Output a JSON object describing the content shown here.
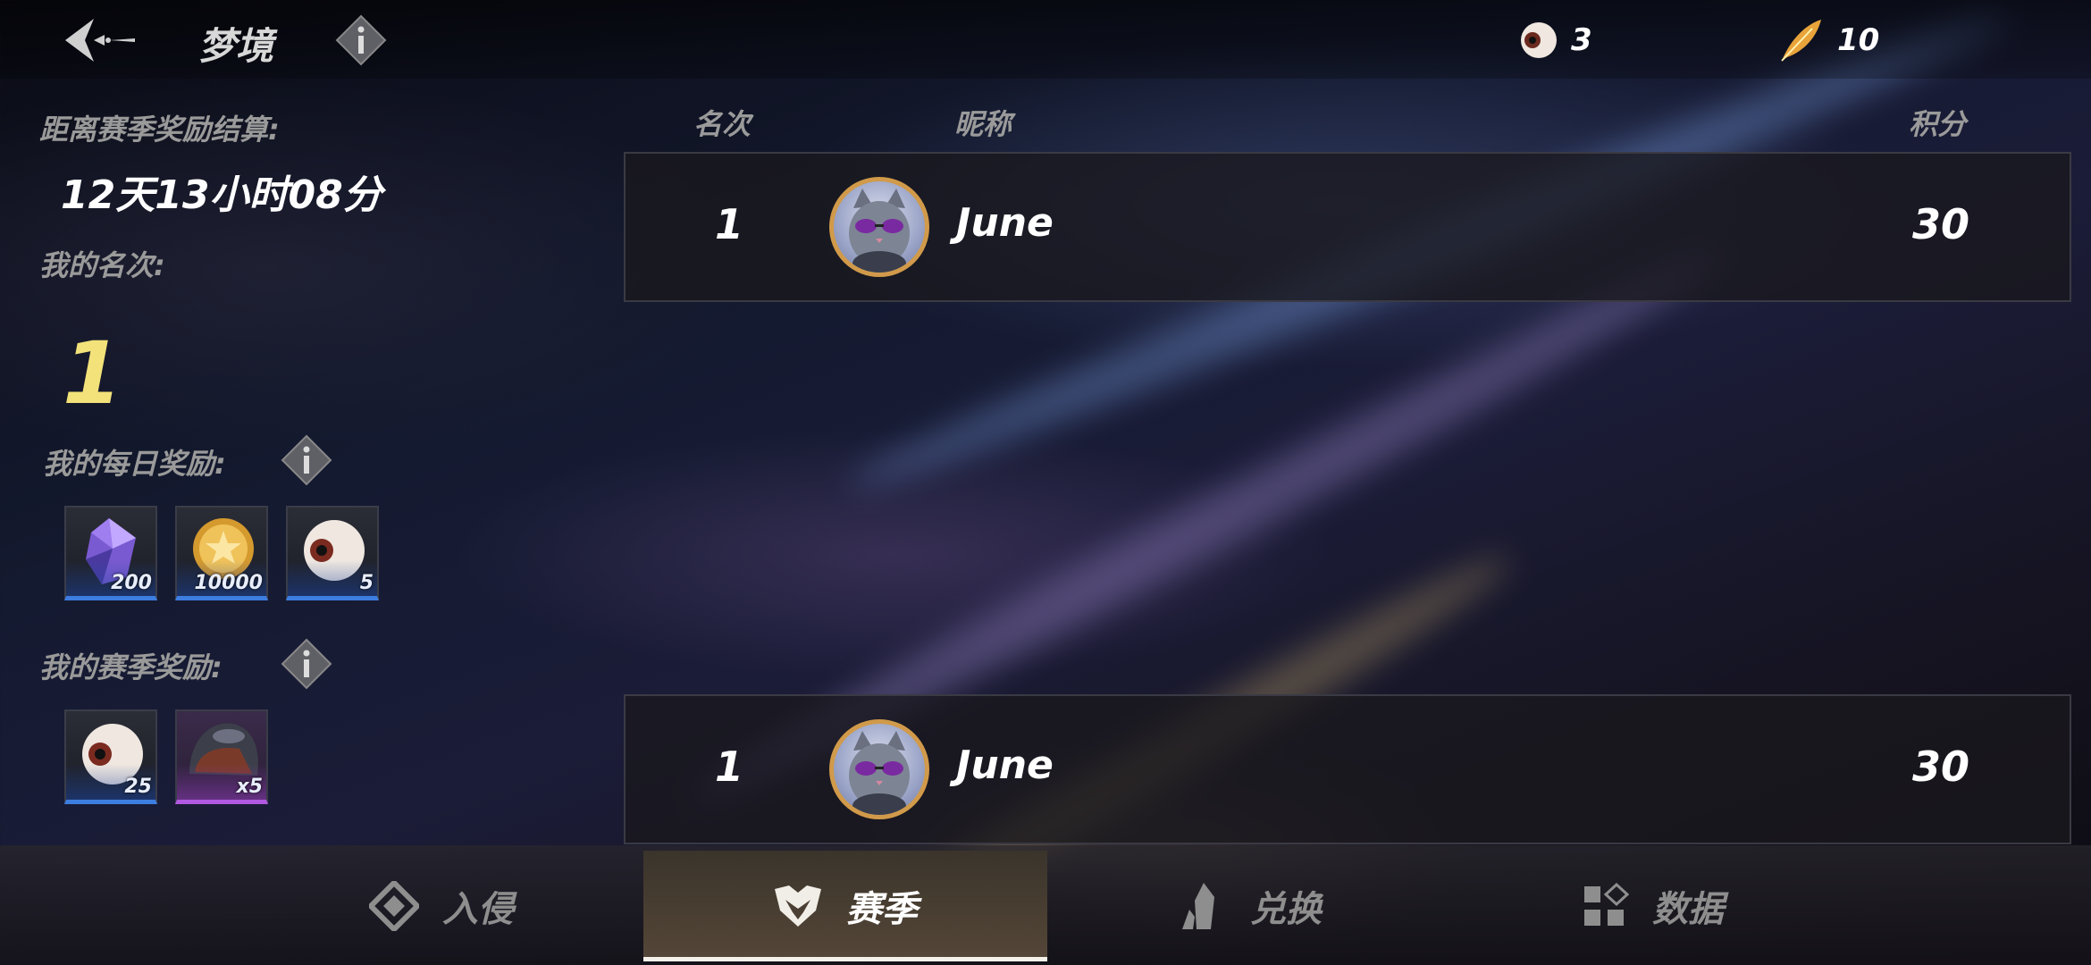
{
  "header": {
    "title": "梦境",
    "resources": [
      {
        "icon": "eyeball-icon",
        "value": "3"
      },
      {
        "icon": "golden-feather-icon",
        "value": "10"
      }
    ]
  },
  "season": {
    "countdown_label": "距离赛季奖励结算:",
    "countdown_value": "12天13小时08分",
    "my_rank_label": "我的名次:",
    "my_rank_value": "1",
    "daily_rewards_label": "我的每日奖励:",
    "daily_rewards": [
      {
        "icon": "purple-gem-icon",
        "count": "200"
      },
      {
        "icon": "gold-coin-icon",
        "count": "10000"
      },
      {
        "icon": "eyeball-icon",
        "count": "5"
      }
    ],
    "season_rewards_label": "我的赛季奖励:",
    "season_rewards": [
      {
        "icon": "eyeball-icon",
        "count": "25"
      },
      {
        "icon": "helmet-icon",
        "count": "x5"
      }
    ]
  },
  "leaderboard": {
    "columns": {
      "rank": "名次",
      "nickname": "昵称",
      "score": "积分"
    },
    "rows": [
      {
        "rank": "1",
        "name": "June",
        "score": "30"
      }
    ],
    "my_row": {
      "rank": "1",
      "name": "June",
      "score": "30"
    }
  },
  "tabs": [
    {
      "label": "入侵",
      "icon": "invasion-icon",
      "active": false
    },
    {
      "label": "赛季",
      "icon": "season-icon",
      "active": true
    },
    {
      "label": "兑换",
      "icon": "exchange-icon",
      "active": false
    },
    {
      "label": "数据",
      "icon": "data-icon",
      "active": false
    }
  ],
  "colors": {
    "accent_gold": "#f3e27a",
    "avatar_ring": "#d19a4a",
    "reward_blue": "#3d7de0",
    "reward_purple": "#b159e0"
  }
}
